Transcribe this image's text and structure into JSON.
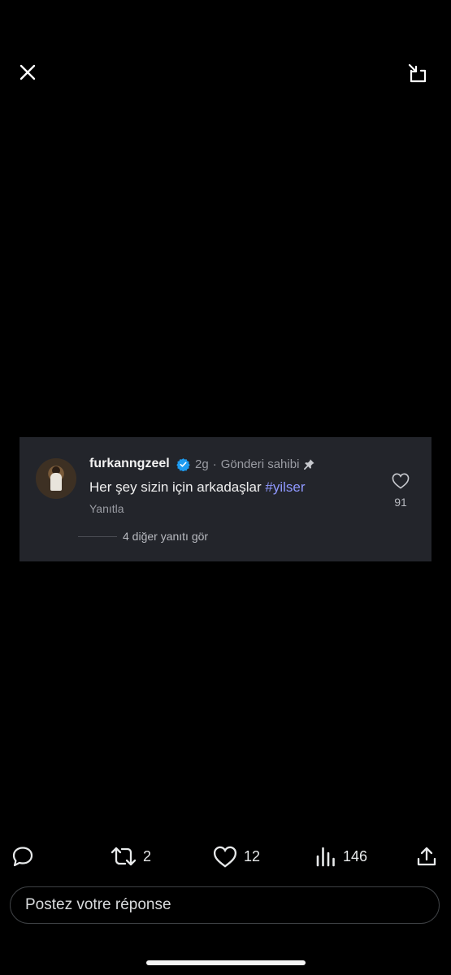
{
  "top_bar": {
    "close_icon": "close-icon",
    "restore_icon": "picture-in-picture-restore-icon"
  },
  "comment_card": {
    "username": "furkanngzeel",
    "verified": true,
    "time": "2g",
    "separator": "·",
    "owner_label": "Gönderi sahibi",
    "text": "Her şey sizin için arkadaşlar ",
    "hashtag": "#yilser",
    "reply_label": "Yanıtla",
    "more_replies": "4 diğer yanıtı gör",
    "like_count": "91",
    "colors": {
      "background": "#23252b",
      "hashtag": "#8f98ff",
      "verified": "#1d9bf0"
    }
  },
  "actions": {
    "reply": {
      "icon": "reply-bubble-icon",
      "count": ""
    },
    "repost": {
      "icon": "repost-icon",
      "count": "2"
    },
    "like": {
      "icon": "heart-icon",
      "count": "12"
    },
    "views": {
      "icon": "views-bar-chart-icon",
      "count": "146"
    },
    "share": {
      "icon": "share-upload-icon",
      "count": ""
    }
  },
  "reply_input": {
    "placeholder": "Postez votre réponse"
  }
}
